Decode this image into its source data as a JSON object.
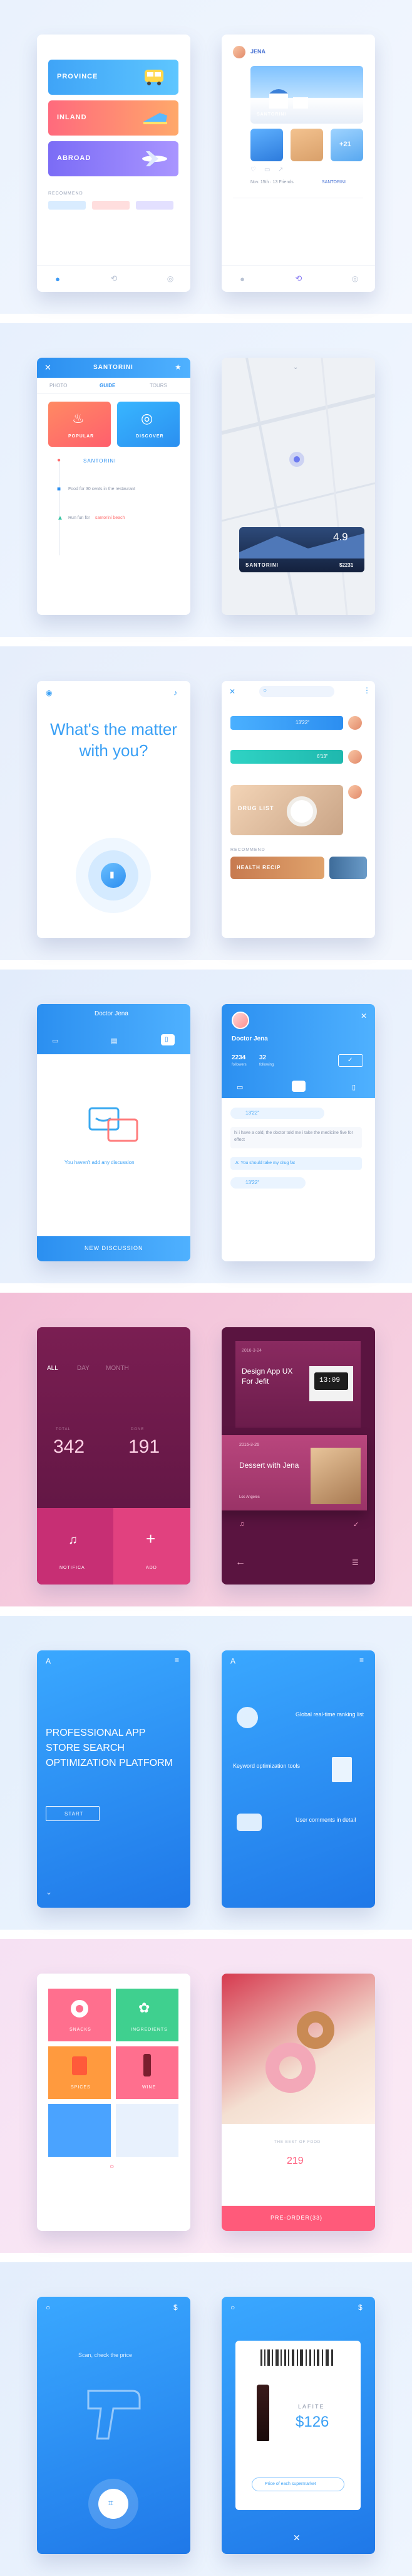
{
  "s1": {
    "categories": [
      "PROVINCE",
      "INLAND",
      "ABROAD"
    ],
    "recommend": "RECOMMEND",
    "profile_name": "JENA",
    "hero_place": "SANTORINI",
    "hero_badge": "+21",
    "meta_line": "Nov. 15th · 13 Friends",
    "meta_place": "SANTORINI"
  },
  "s2": {
    "title": "SANTORINI",
    "tabs": [
      "PHOTO",
      "GUIDE",
      "TOURS"
    ],
    "cards": [
      "POPULAR",
      "DISCOVER"
    ],
    "step1": "SANTORINI",
    "step2": "Food for 30 cents in the restaurant",
    "step3_prefix": "Run fun for",
    "step3_link": "santorini beach",
    "place_card_name": "SANTORINI",
    "place_card_score": "4.9",
    "place_card_price": "$2231"
  },
  "s3": {
    "question": "What's the matter with you?",
    "chip1": "13'22''",
    "chip2": "6'13''",
    "food_label": "DRUG LIST",
    "recommend": "RECOMMEND",
    "health_label": "HEALTH RECIP"
  },
  "s4": {
    "title": "Doctor Jena",
    "empty_text": "You haven't add any discussion",
    "button": "NEW DISCUSSION",
    "profile_name": "Doctor Jena",
    "stats": [
      {
        "value": "2234",
        "label": "followers"
      },
      {
        "value": "32",
        "label": "following"
      }
    ],
    "voice": "13'22''",
    "msg1": "hi i have a cold, the doctor told me i take the medicine five for effect",
    "msg2": "A: You should take my drug fat",
    "voice2": "13'22''"
  },
  "s5": {
    "tabs": [
      "ALL",
      "DAY",
      "MONTH"
    ],
    "stats": [
      {
        "label": "TOTAL",
        "value": "342"
      },
      {
        "label": "DONE",
        "value": "191"
      }
    ],
    "buttons": [
      "NOTIFICA",
      "ADD"
    ],
    "task1_date": "2016-3-24",
    "task1_title": "Design App UX For Jefit",
    "clock": "13:09",
    "task2_date": "2016-3-26",
    "task2_title": "Dessert with Jena",
    "task2_place": "Los Angeles"
  },
  "s6": {
    "logo": "A",
    "headline": "PROFESSIONAL APP STORE SEARCH OPTIMIZATION PLATFORM",
    "start": "START",
    "features": [
      "Global real-time ranking list",
      "Keyword optimization tools",
      "User comments in detail"
    ]
  },
  "s7": {
    "tiles": [
      "SNACKS",
      "INGREDIENTS",
      "SPICES",
      "WINE"
    ],
    "best": "THE BEST OF FOOD",
    "price": "219",
    "order": "PRE-ORDER(33)"
  },
  "s8": {
    "scan_text": "Scan, check the price",
    "brand": "LAFITE",
    "price": "$126",
    "compare": "Price of each supermarket"
  }
}
